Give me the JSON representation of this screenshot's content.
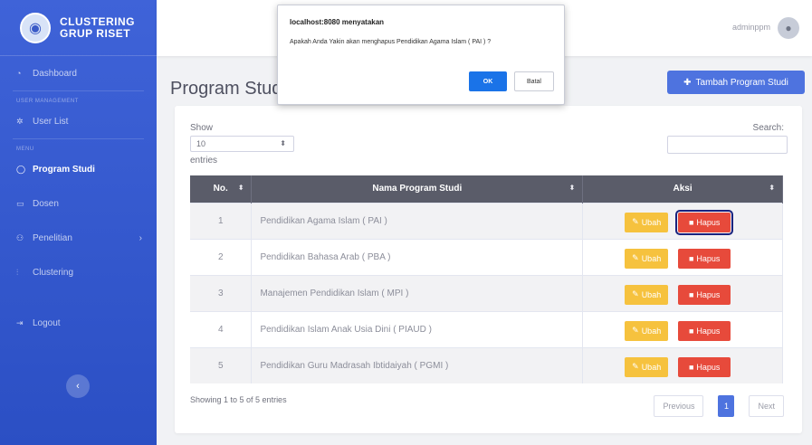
{
  "sidebar": {
    "brand_line1": "CLUSTERING",
    "brand_line2": "GRUP RISET",
    "dashboard": "Dashboard",
    "heading_user_mgmt": "USER MANAGEMENT",
    "user_list": "User List",
    "heading_menu": "MENU",
    "program_studi": "Program Studi",
    "dosen": "Dosen",
    "penelitian": "Penelitian",
    "clustering": "Clustering",
    "logout": "Logout"
  },
  "topbar": {
    "user": "adminppm"
  },
  "page": {
    "title": "Program Studi",
    "add_button": "Tambah Program Studi"
  },
  "table_controls": {
    "show": "Show",
    "length_value": "10",
    "entries": "entries",
    "search_label": "Search:"
  },
  "table": {
    "headers": [
      "No.",
      "Nama Program Studi",
      "Aksi"
    ],
    "rows": [
      {
        "no": "1",
        "name": "Pendidikan Agama Islam ( PAI )"
      },
      {
        "no": "2",
        "name": "Pendidikan Bahasa Arab ( PBA )"
      },
      {
        "no": "3",
        "name": "Manajemen Pendidikan Islam ( MPI )"
      },
      {
        "no": "4",
        "name": "Pendidikan Islam Anak Usia Dini ( PIAUD )"
      },
      {
        "no": "5",
        "name": "Pendidikan Guru Madrasah Ibtidaiyah ( PGMI )"
      }
    ],
    "edit_label": "Ubah",
    "delete_label": "Hapus"
  },
  "footer": {
    "info": "Showing 1 to 5 of 5 entries",
    "previous": "Previous",
    "page": "1",
    "next": "Next"
  },
  "dialog": {
    "title": "localhost:8080 menyatakan",
    "message": "Apakah Anda Yakin akan menghapus Pendidikan Agama Islam ( PAI ) ?",
    "ok": "OK",
    "cancel": "Batal"
  },
  "colors": {
    "primary": "#4e73df",
    "warning": "#f6c23e",
    "danger": "#e74a3b",
    "table_header": "#5a5c69"
  }
}
